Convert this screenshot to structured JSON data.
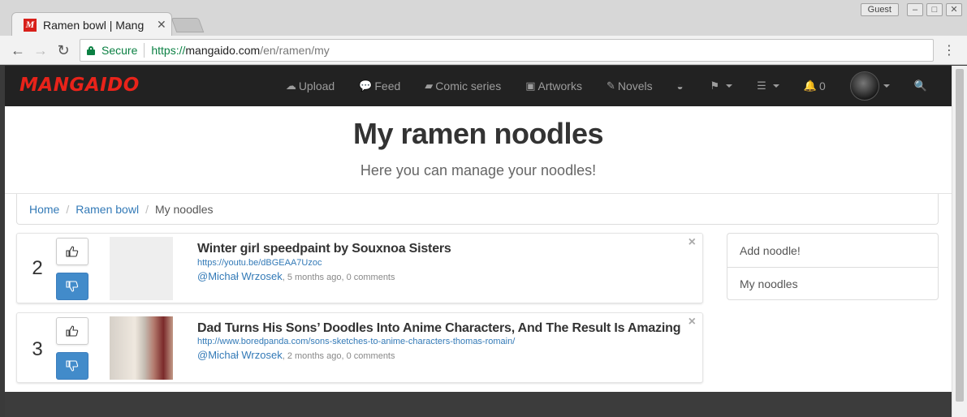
{
  "browser": {
    "tab_title": "Ramen bowl | Mang",
    "secure_label": "Secure",
    "url_scheme": "https://",
    "url_host": "mangaido.com",
    "url_path": "/en/ramen/my",
    "guest_label": "Guest"
  },
  "navbar": {
    "brand": "MANGAIDO",
    "items": [
      {
        "icon": "cloud-upload-icon",
        "label": "Upload"
      },
      {
        "icon": "comments-icon",
        "label": "Feed"
      },
      {
        "icon": "book-icon",
        "label": "Comic series"
      },
      {
        "icon": "picture-icon",
        "label": "Artworks"
      },
      {
        "icon": "edit-icon",
        "label": "Novels"
      }
    ],
    "notifications_count": "0"
  },
  "header": {
    "title": "My ramen noodles",
    "subtitle": "Here you can manage your noodles!"
  },
  "breadcrumb": {
    "home": "Home",
    "ramen_bowl": "Ramen bowl",
    "current": "My noodles"
  },
  "noodles": [
    {
      "score": "2",
      "title": "Winter girl speedpaint by Souxnoa Sisters",
      "url": "https://youtu.be/dBGEAA7Uzoc",
      "author": "@Michał Wrzosek",
      "meta": ", 5 months ago, 0 comments"
    },
    {
      "score": "3",
      "title": "Dad Turns His Sons’ Doodles Into Anime Characters, And The Result Is Amazing",
      "url": "http://www.boredpanda.com/sons-sketches-to-anime-characters-thomas-romain/",
      "author": "@Michał Wrzosek",
      "meta": ", 2 months ago, 0 comments"
    }
  ],
  "sidebar": {
    "add_noodle": "Add noodle!",
    "my_noodles": "My noodles"
  }
}
